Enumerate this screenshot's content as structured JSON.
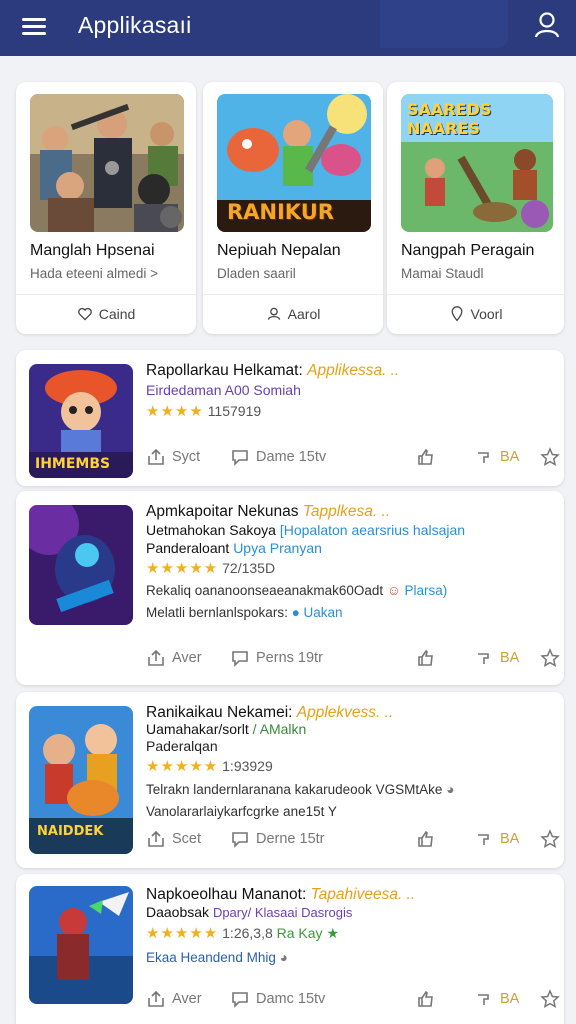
{
  "header": {
    "title": "Applikasaıi",
    "menu_icon": "menu-icon",
    "profile_icon": "person-icon",
    "bar_color": "#2b3b7e"
  },
  "featured": [
    {
      "name": "Manglah Hpsenai",
      "subtitle": "Hada eteeni almedi >",
      "action": "Caind",
      "action_icon": "heart-icon"
    },
    {
      "name": "Nepiuah Nepalan",
      "subtitle": "Dladen saaril",
      "action": "Aarol",
      "action_icon": "person-icon",
      "logo_text": "RANIKUR"
    },
    {
      "name": "Nangpah Peragain",
      "subtitle": "Mamai Staudl",
      "action": "Voorl",
      "action_icon": "pin-icon",
      "banner_text": "SAAREDS NAARES"
    }
  ],
  "apps": [
    {
      "title": "Rapollarkau Helkamat:",
      "title_highlight": "Applikessa. ..",
      "lines": [
        {
          "text": "Eirdedaman A00 Somiah",
          "color": "#6a3fb0"
        }
      ],
      "stars": "★★★★",
      "rating": "1157919",
      "actions": [
        "Syct",
        "Dame 15tv",
        "BA"
      ],
      "thumb_text": "IHMEMBS"
    },
    {
      "title": "Apmkapoitar Nekunas",
      "title_highlight": "Tapplkesa. ..",
      "lines": [
        {
          "text": "Uetmahokan Sakoya",
          "color": "#111"
        },
        {
          "text": "[Hopalaton aearsrius halsajan",
          "color": "#2a8fd6"
        },
        {
          "text": "Panderaloant",
          "color": "#111"
        },
        {
          "text": "Upya Pranyan",
          "color": "#2a8fd6"
        },
        {
          "text": "Rekaliq oananoonseaeanakmak60Oadt",
          "color": "#333"
        },
        {
          "text": "Plarsa)",
          "color": "#2a8fd6"
        },
        {
          "text": "Melatli bernlanlspokars:",
          "color": "#333"
        },
        {
          "text": "Uakan",
          "color": "#2a8fd6"
        }
      ],
      "stars": "★★★★★",
      "rating": "72/135D",
      "actions": [
        "Aver",
        "Perns 19tr",
        "BA"
      ]
    },
    {
      "title": "Ranikaikau Nekamei:",
      "title_highlight": "Applekvess. ..",
      "lines": [
        {
          "text": "Uamahakar/sorlt",
          "color": "#111"
        },
        {
          "text": "/ AMalkn",
          "color": "#3a8a3a"
        },
        {
          "text": "Paderalqan",
          "color": "#111"
        },
        {
          "text": "Telrakn landernlaranana kakarudeook VGSMtAke",
          "color": "#333"
        },
        {
          "text": "Vanolararlaiykarfcgrke ane15t  Y",
          "color": "#333"
        }
      ],
      "stars": "★★★★★",
      "rating": "1:93929",
      "actions": [
        "Scet",
        "Derne 15tr",
        "BA"
      ],
      "thumb_text": "NAIDDEK"
    },
    {
      "title": "Napkoeolhau Mananot:",
      "title_highlight": "Tapahiveesa. ..",
      "lines": [
        {
          "text": "Daaobsak",
          "color": "#111"
        },
        {
          "text": "Dpary/ Klasaai Dasrogis",
          "color": "#6a3fb0"
        },
        {
          "text": "Ekaa Heandend Mhig",
          "color": "#2a5fb0"
        }
      ],
      "stars": "★★★★★",
      "rating": "1:26,3,8",
      "rating_extra": "Ra Kay ★",
      "actions": [
        "Aver",
        "Damc 15tv",
        "BA"
      ]
    }
  ]
}
